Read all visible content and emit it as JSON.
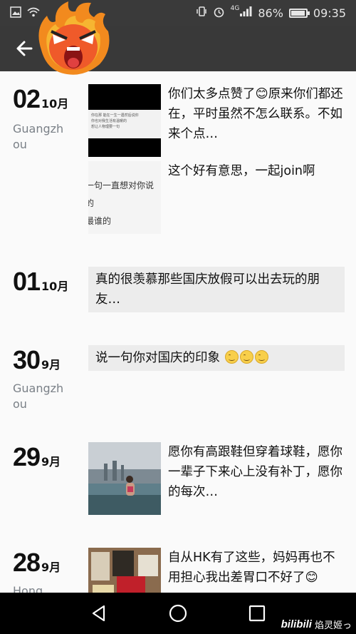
{
  "status_bar": {
    "network": "4G",
    "battery": "86%",
    "battery_level": 0.86,
    "time": "09:35"
  },
  "header": {
    "back_icon": "arrow-left-icon",
    "avatar_icon": "angry-flame-face-avatar"
  },
  "entries": [
    {
      "day": "02",
      "month": "10月",
      "location": "Guangzhou",
      "posts": [
        {
          "kind": "image",
          "text": "你们太多点赞了😊原来你们都还在，平时虽然不怎么联系。不如来个点…",
          "image_text": [
            "你在那 能在一生一遇然后说你",
            "你也对我生活有温暖的",
            "想让人物理要一句"
          ]
        },
        {
          "kind": "image",
          "text": "这个好有意思，一起join啊",
          "image_text": [
            "一句一直想对你说的",
            "最谁的",
            "一句"
          ]
        }
      ]
    },
    {
      "day": "01",
      "month": "10月",
      "location": "",
      "posts": [
        {
          "kind": "text",
          "text": "真的很羡慕那些国庆放假可以出去玩的朋友…"
        }
      ]
    },
    {
      "day": "30",
      "month": "9月",
      "location": "Guangzhou",
      "posts": [
        {
          "kind": "text",
          "text": "说一句你对国庆的印象"
        }
      ]
    },
    {
      "day": "29",
      "month": "9月",
      "location": "",
      "posts": [
        {
          "kind": "image",
          "text": "愿你有高跟鞋但穿着球鞋，愿你一辈子下来心上没有补丁，愿你的每次…"
        }
      ]
    },
    {
      "day": "28",
      "month": "9月",
      "location": "Hong",
      "posts": [
        {
          "kind": "image",
          "text": "自从HK有了这些，妈妈再也不用担心我出差胃口不好了😊"
        }
      ]
    }
  ],
  "nav": {
    "back_icon": "triangle-back-icon",
    "home_icon": "circle-home-icon",
    "recents_icon": "square-recents-icon"
  },
  "watermark": {
    "logo": "bilibili",
    "text": "焰灵姬っ"
  }
}
